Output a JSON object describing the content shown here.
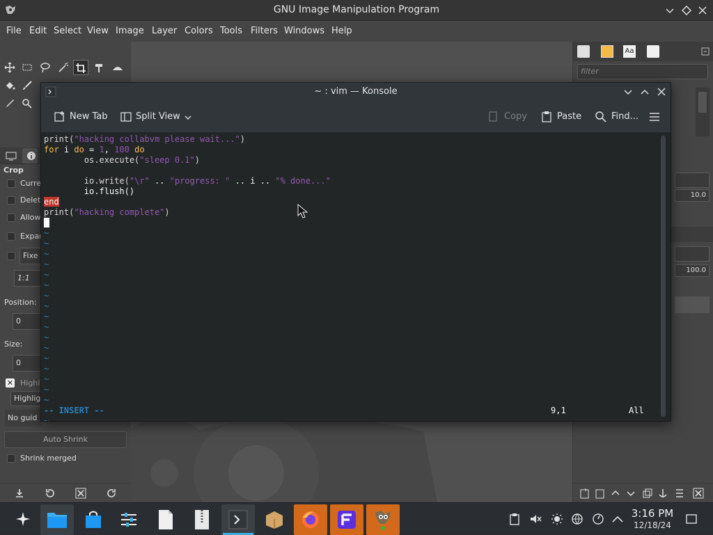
{
  "gimp": {
    "title": "GNU Image Manipulation Program",
    "menu": [
      "File",
      "Edit",
      "Select",
      "View",
      "Image",
      "Layer",
      "Colors",
      "Tools",
      "Filters",
      "Windows",
      "Help"
    ],
    "tool_options": {
      "heading": "Crop",
      "options": [
        "Curre",
        "Delet",
        "Allow",
        "Expan",
        "Fixe"
      ],
      "ratio": "1:1",
      "position_label": "Position:",
      "position_value": "0",
      "size_label": "Size:",
      "size_value": "0",
      "highlight_label": "Highl",
      "highlight_field": "Highlig",
      "guides": "No guid",
      "auto_shrink": "Auto Shrink",
      "shrink_merged": "Shrink merged"
    },
    "right_dock": {
      "filter_placeholder": "filter",
      "value1": "10.0",
      "value2": "100.0"
    }
  },
  "konsole": {
    "title": "~ : vim — Konsole",
    "toolbar": {
      "new_tab": "New Tab",
      "split_view": "Split View",
      "copy": "Copy",
      "paste": "Paste",
      "find": "Find..."
    },
    "code": {
      "l1_fn": "print(",
      "l1_str": "\"hacking collabvm please wait...\"",
      "l1_end": ")",
      "l2_kw1": "for",
      "l2_mid": " i ",
      "l2_kw2": "do",
      "l2_eq": " = ",
      "l2_n1": "1",
      "l2_comma": ", ",
      "l2_n2": "100",
      "l2_sp": " ",
      "l2_kw3": "do",
      "l3_fn": "        os.execute(",
      "l3_str": "\"sleep 0.1\"",
      "l3_end": ")",
      "l5_fn": "        io.write(",
      "l5_s1": "\"\\r\"",
      "l5_op1": " .. ",
      "l5_s2": "\"progress: \"",
      "l5_op2": " .. i .. ",
      "l5_s3": "\"% done...\"",
      "l6": "        io.flush()",
      "l7": "end",
      "l8_fn": "print(",
      "l8_str": "\"hacking complete\"",
      "l8_end": ")"
    },
    "status": {
      "mode": "-- INSERT --",
      "position": "9,1",
      "scroll": "All"
    }
  },
  "taskbar": {
    "time": "3:16 PM",
    "date": "12/18/24"
  }
}
